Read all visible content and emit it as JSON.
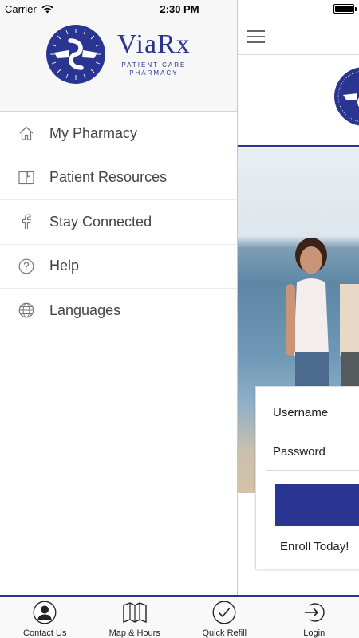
{
  "status_bar": {
    "carrier": "Carrier",
    "time": "2:30 PM",
    "battery_level": 1.0
  },
  "brand": {
    "name": "ViaRx",
    "subtitle_line1": "PATIENT CARE",
    "subtitle_line2": "PHARMACY",
    "color": "#2a3592"
  },
  "drawer": {
    "items": [
      {
        "label": "My Pharmacy",
        "icon": "home-icon"
      },
      {
        "label": "Patient Resources",
        "icon": "book-icon"
      },
      {
        "label": "Stay Connected",
        "icon": "facebook-icon"
      },
      {
        "label": "Help",
        "icon": "question-circle-icon"
      },
      {
        "label": "Languages",
        "icon": "globe-icon"
      }
    ]
  },
  "login": {
    "username_placeholder": "Username",
    "password_placeholder": "Password",
    "enroll_label": "Enroll Today!"
  },
  "tab_bar": {
    "tabs": [
      {
        "label": "Contact Us",
        "icon": "contact-person-icon"
      },
      {
        "label": "Map & Hours",
        "icon": "map-icon"
      },
      {
        "label": "Quick Refill",
        "icon": "checkmark-circle-icon"
      },
      {
        "label": "Login",
        "icon": "login-icon"
      }
    ]
  }
}
